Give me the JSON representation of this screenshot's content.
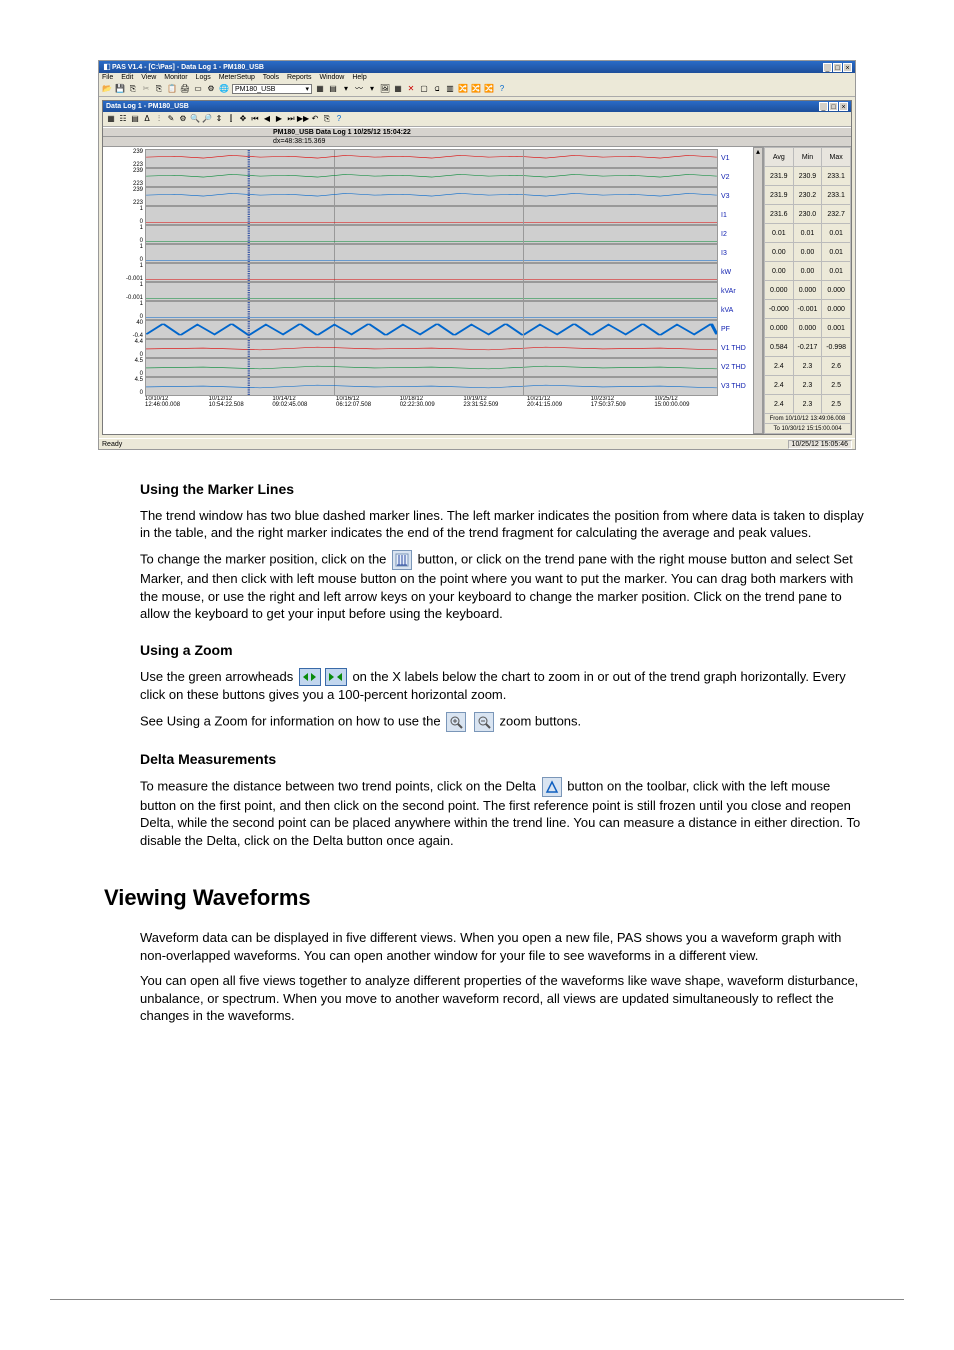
{
  "app": {
    "title": "PAS V1.4 - [C:\\Pas] - Data Log 1 - PM180_USB",
    "menu": [
      "File",
      "Edit",
      "View",
      "Monitor",
      "Logs",
      "MeterSetup",
      "Tools",
      "Reports",
      "Window",
      "Help"
    ],
    "device": "PM180_USB"
  },
  "chartWindow": {
    "title": "Data Log 1 - PM180_USB",
    "header": "PM180_USB Data Log 1  10/25/12 15:04:22",
    "dx": "dx=48:38:15.369"
  },
  "chart_data": {
    "type": "line",
    "x_ticks": [
      {
        "d": "10/10/12",
        "t": "12:46:00.008"
      },
      {
        "d": "10/12/12",
        "t": "10:54:22.508"
      },
      {
        "d": "10/14/12",
        "t": "09:02:45.008"
      },
      {
        "d": "10/16/12",
        "t": "06:12:07.508"
      },
      {
        "d": "10/18/12",
        "t": "02:22:30.009"
      },
      {
        "d": "10/19/12",
        "t": "23:31:52.509"
      },
      {
        "d": "10/21/12",
        "t": "20:41:15.009"
      },
      {
        "d": "10/23/12",
        "t": "17:50:37.509"
      },
      {
        "d": "10/25/12",
        "t": "15:00:00.009"
      }
    ],
    "series": [
      {
        "name": "V1",
        "ylim": [
          223.0,
          239.0
        ],
        "color": "#d00"
      },
      {
        "name": "V2",
        "ylim": [
          223.0,
          239.0
        ],
        "color": "#083"
      },
      {
        "name": "V3",
        "ylim": [
          223.0,
          239.0
        ],
        "color": "#06c"
      },
      {
        "name": "I1",
        "ylim": [
          0.0,
          1.0
        ],
        "color": "#d00"
      },
      {
        "name": "I2",
        "ylim": [
          0.0,
          1.0
        ],
        "color": "#083"
      },
      {
        "name": "I3",
        "ylim": [
          0.0,
          1.0
        ],
        "color": "#06c"
      },
      {
        "name": "kW",
        "ylim": [
          -0.001,
          1.0
        ],
        "color": "#d00"
      },
      {
        "name": "kVAr",
        "ylim": [
          -0.001,
          1.0
        ],
        "color": "#083"
      },
      {
        "name": "kVA",
        "ylim": [
          0.0,
          1.0
        ],
        "color": "#06c"
      },
      {
        "name": "PF",
        "ylim": [
          -0.4,
          40
        ],
        "color": "#06c"
      },
      {
        "name": "V1 THD",
        "ylim": [
          0.0,
          4.4
        ],
        "color": "#d00"
      },
      {
        "name": "V2 THD",
        "ylim": [
          0.0,
          4.5
        ],
        "color": "#083"
      },
      {
        "name": "V3 THD",
        "ylim": [
          0.0,
          4.5
        ],
        "color": "#06c"
      }
    ],
    "stats_header": [
      "Avg",
      "Min",
      "Max"
    ],
    "stats": [
      [
        "231.9",
        "230.9",
        "233.1"
      ],
      [
        "231.9",
        "230.2",
        "233.1"
      ],
      [
        "231.6",
        "230.0",
        "232.7"
      ],
      [
        "0.01",
        "0.01",
        "0.01"
      ],
      [
        "0.00",
        "0.00",
        "0.01"
      ],
      [
        "0.00",
        "0.00",
        "0.01"
      ],
      [
        "0.000",
        "0.000",
        "0.000"
      ],
      [
        "-0.000",
        "-0.001",
        "0.000"
      ],
      [
        "0.000",
        "0.000",
        "0.001"
      ],
      [
        "0.584",
        "-0.217",
        "-0.998"
      ],
      [
        "2.4",
        "2.3",
        "2.6"
      ],
      [
        "2.4",
        "2.3",
        "2.5"
      ],
      [
        "2.4",
        "2.3",
        "2.5"
      ]
    ],
    "from": "From 10/10/12 13:49:06.008",
    "to": "To  10/30/12 15:15:00.004"
  },
  "statusbar": {
    "ready": "Ready",
    "clock": "10/25/12 15:05:46"
  },
  "doc": {
    "h_marker": "Using the Marker Lines",
    "p_marker_1": "The trend window has two blue dashed marker lines. The left marker indicates the position from where data is taken to display in the table, and the right marker indicates the end of the trend fragment for calculating the average and peak values.",
    "p_marker_2": "To change the marker position, click on the",
    "p_marker_2b": "button, or click on the trend pane with the right mouse button and select Set Marker, and then click with left mouse button on the point where you want to put the marker. You can drag both markers with the mouse, or use the right and left arrow keys on your keyboard to change the marker position. Click on the trend pane to allow the keyboard to get your input before using the keyboard.",
    "h_zoom": "Using a Zoom",
    "p_zoom_1": "Use the green arrowheads",
    "p_zoom_1b": "on the X labels below the chart to zoom in or out of the trend graph horizontally. Every click on these buttons gives you a 100-percent horizontal zoom.",
    "p_zoom_2": "See Using a Zoom for information on how to use the",
    "p_zoom_2b": "zoom buttons.",
    "h_delta": "Delta Measurements",
    "p_delta_1": "To measure the distance between two trend points, click on the Delta",
    "p_delta_1b": "button on the toolbar, click with the left mouse button on the first point, and then click on the second point. The first reference point is still frozen until you close and reopen Delta, while the second point can be placed anywhere within the trend line. You can measure a distance in either direction. To disable the Delta, click on the Delta button once again.",
    "h1": "Viewing Waveforms",
    "p_wave_1": "Waveform data can be displayed in five different views. When you open a new file, PAS shows you a waveform graph with non-overlapped waveforms. You can open another window for your file to see waveforms in a different view.",
    "p_wave_2": "You can open all five views together to analyze different properties of the waveforms like wave shape, waveform disturbance, unbalance, or spectrum. When you move to another waveform record, all views are updated simultaneously to reflect the changes in the waveforms."
  }
}
